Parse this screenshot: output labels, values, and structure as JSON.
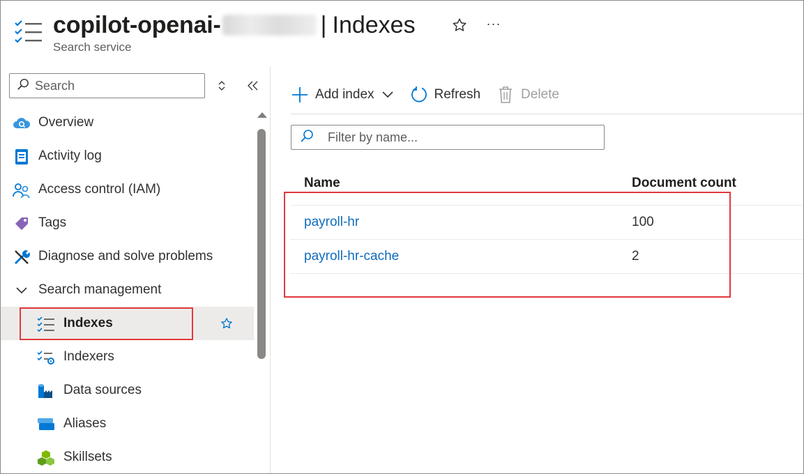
{
  "header": {
    "title_prefix": "copilot-openai-",
    "separator": "|",
    "page_name": "Indexes",
    "subtitle": "Search service",
    "more_label": "···"
  },
  "sidebar": {
    "search_placeholder": "Search",
    "items": [
      {
        "label": "Overview",
        "icon": "cloud-search-icon"
      },
      {
        "label": "Activity log",
        "icon": "activity-log-icon"
      },
      {
        "label": "Access control (IAM)",
        "icon": "people-icon"
      },
      {
        "label": "Tags",
        "icon": "tag-icon"
      },
      {
        "label": "Diagnose and solve problems",
        "icon": "wrench-icon"
      },
      {
        "label": "Search management",
        "icon": "chevron-down-icon"
      },
      {
        "label": "Indexes",
        "icon": "indexes-icon",
        "selected": true
      },
      {
        "label": "Indexers",
        "icon": "indexers-icon"
      },
      {
        "label": "Data sources",
        "icon": "data-sources-icon"
      },
      {
        "label": "Aliases",
        "icon": "aliases-icon"
      },
      {
        "label": "Skillsets",
        "icon": "skillsets-icon"
      }
    ]
  },
  "toolbar": {
    "add_index_label": "Add index",
    "refresh_label": "Refresh",
    "delete_label": "Delete"
  },
  "filter": {
    "placeholder": "Filter by name..."
  },
  "table": {
    "columns": [
      "Name",
      "Document count"
    ],
    "rows": [
      {
        "name": "payroll-hr",
        "count": "100"
      },
      {
        "name": "payroll-hr-cache",
        "count": "2"
      }
    ]
  },
  "colors": {
    "link": "#0f6cbd",
    "accent": "#0078d4",
    "highlight_box": "#e0393e",
    "selected_bg": "#edebe9"
  }
}
